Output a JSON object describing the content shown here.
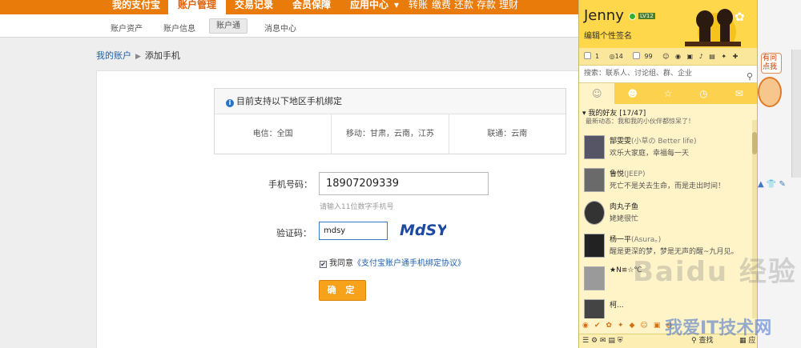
{
  "topnav": {
    "items": [
      "我的支付宝",
      "账户管理",
      "交易记录",
      "会员保障",
      "应用中心",
      "▾"
    ],
    "quick": [
      "转账",
      "缴费",
      "还款",
      "存款",
      "理财"
    ]
  },
  "subnav": {
    "items": [
      "账户资产",
      "账户信息",
      "账户通",
      "消息中心"
    ]
  },
  "breadcrumb": {
    "root": "我的账户",
    "current": "添加手机"
  },
  "support": {
    "title": "目前支持以下地区手机绑定",
    "carriers": [
      "电信：全国",
      "移动：甘肃，云南，江苏",
      "联通：云南"
    ]
  },
  "form": {
    "phone_label": "手机号码：",
    "phone_value": "18907209339",
    "phone_hint": "请输入11位数字手机号",
    "code_label": "验证码：",
    "code_value": "mdsy",
    "captcha_text": "MdSY",
    "agree_prefix": "我同意",
    "agree_link": "《支付宝账户通手机绑定协议》",
    "confirm_label": "确 定"
  },
  "side": {
    "tag": "有问点我"
  },
  "qq": {
    "username": "Jenny",
    "vip": "LV12",
    "signature": "编辑个性签名",
    "counters": [
      "1",
      "14",
      "99",
      "1"
    ],
    "search_placeholder": "搜索：联系人、讨论组、群、企业",
    "group_name": "我的好友",
    "group_count": "[17/47]",
    "partial_status": "最新动态：我和我的小伙伴都惊呆了！",
    "friends": [
      {
        "name": "郜雯雯",
        "sub": "(小草の Better life)",
        "status": "欢乐大家庭，幸福每一天"
      },
      {
        "name": "鲁悦",
        "sub": "(JEEP)",
        "status": "死亡不是关去生命，而是走出时间！"
      },
      {
        "name": "肉丸子鱼",
        "sub": "",
        "status": "姥姥很忙"
      },
      {
        "name": "杨一平",
        "sub": "(Asura。)",
        "status": "醒是更深的梦，梦是无声的醒~九月见。"
      },
      {
        "name": "★N≌☆℃",
        "sub": "",
        "status": ""
      },
      {
        "name": "柯...",
        "sub": "",
        "status": ""
      }
    ],
    "bottom_find": "查找",
    "bottom_app": "应用"
  },
  "watermark": {
    "main": "Baidu 经验",
    "sub": "我爱IT技术网"
  },
  "colors": {
    "brand_orange": "#e97b0b",
    "button_orange": "#f7a21a",
    "qq_yellow": "#ffd74a",
    "link_blue": "#1f5fa8"
  }
}
